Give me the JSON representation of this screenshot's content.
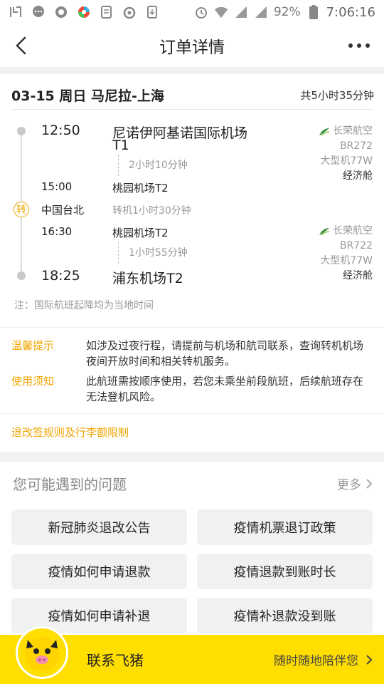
{
  "status_bar": {
    "left_icons": [
      "hearing-icon",
      "chat-icon",
      "message-icon",
      "camera-app-icon",
      "doc-icon",
      "swirl-app-icon",
      "download-icon"
    ],
    "battery": "92%",
    "time": "7:06:16"
  },
  "header": {
    "title": "订单详情",
    "back_icon": "chevron-left-icon",
    "more_icon": "more-dots-icon"
  },
  "flight": {
    "route_title": "03-15 周日 马尼拉-上海",
    "total_duration": "共5小时35分钟",
    "segments": [
      {
        "depart_time": "12:50",
        "depart_airport": "尼诺伊阿基诺国际机场",
        "depart_terminal": "T1",
        "duration": "2小时10分钟",
        "arrive_time": "15:00",
        "arrive_airport": "桃园机场T2",
        "airline": "长荣航空",
        "flight_no": "BR272",
        "aircraft": "大型机77W",
        "cabin": "经济舱"
      },
      {
        "depart_time": "16:30",
        "depart_airport": "桃园机场T2",
        "duration": "1小时55分钟",
        "arrive_time": "18:25",
        "arrive_airport": "浦东机场T2",
        "airline": "长荣航空",
        "flight_no": "BR722",
        "aircraft": "大型机77W",
        "cabin": "经济舱"
      }
    ],
    "transfer": {
      "badge": "转",
      "city": "中国台北",
      "info": "转机1小时30分钟"
    },
    "note": "注：国际航班起降均为当地时间",
    "tips": [
      {
        "label": "温馨提示",
        "text": "如涉及过夜行程，请提前与机场和航司联系，查询转机机场夜间开放时间和相关转机服务。"
      },
      {
        "label": "使用须知",
        "text": "此航班需按顺序使用，若您未乘坐前段航班，后续航班存在无法登机风险。"
      }
    ],
    "rules_link": "退改签规则及行李额限制"
  },
  "faq": {
    "title": "您可能遇到的问题",
    "more": "更多",
    "items": [
      "新冠肺炎退改公告",
      "疫情机票退订政策",
      "疫情如何申请退款",
      "疫情退款到账时长",
      "疫情如何申请补退",
      "疫情补退款没到账"
    ]
  },
  "bottom": {
    "contact": "联系飞猪",
    "companion": "随时随地陪伴您"
  },
  "colors": {
    "accent": "#f0a500",
    "bottom_bar": "#ffde00",
    "airline_logo": "#2e8b3a"
  }
}
